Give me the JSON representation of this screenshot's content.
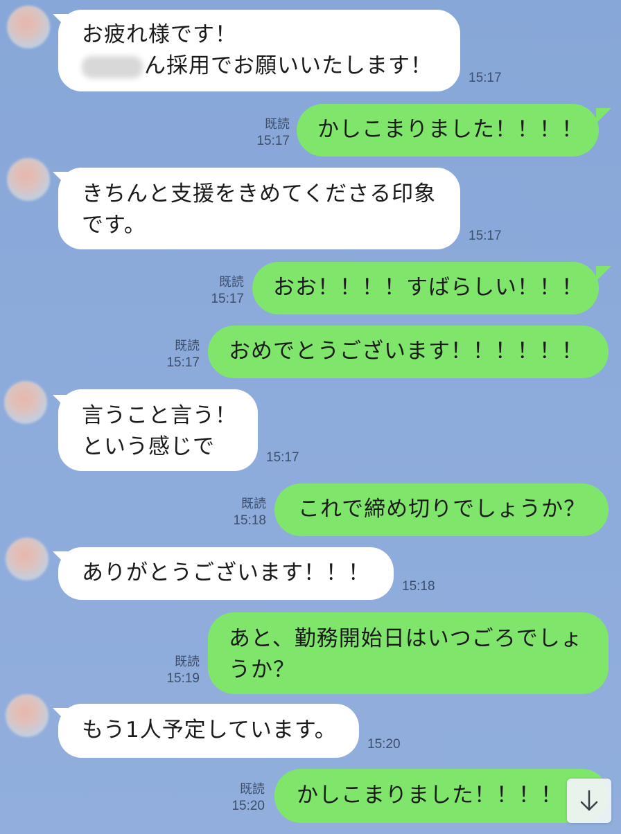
{
  "messages": [
    {
      "id": "m1",
      "side": "in",
      "lines": [
        "お疲れ様です！",
        "ん採用でお願いいたします！"
      ],
      "time": "15:17"
    },
    {
      "id": "m2",
      "side": "out",
      "text": "かしこまりました！！！！",
      "read": "既読",
      "time": "15:17"
    },
    {
      "id": "m3",
      "side": "in",
      "text": "きちんと支援をきめてくださる印象\nです。",
      "time": "15:17"
    },
    {
      "id": "m4",
      "side": "out",
      "text": "おお！！！！すばらしい！！！",
      "read": "既読",
      "time": "15:17"
    },
    {
      "id": "m5",
      "side": "out",
      "text": "おめでとうございます！！！！！！",
      "read": "既読",
      "time": "15:17"
    },
    {
      "id": "m6",
      "side": "in",
      "text": "言うこと言う！\nという感じで",
      "time": "15:17"
    },
    {
      "id": "m7",
      "side": "out",
      "text": "これで締め切りでしょうか？",
      "read": "既読",
      "time": "15:18"
    },
    {
      "id": "m8",
      "side": "in",
      "text": "ありがとうございます！！！",
      "time": "15:18"
    },
    {
      "id": "m9",
      "side": "out",
      "text": "あと、勤務開始日はいつごろでしょ\nうか？",
      "read": "既読",
      "time": "15:19"
    },
    {
      "id": "m10",
      "side": "in",
      "text": "もう1人予定しています。",
      "time": "15:20"
    },
    {
      "id": "m11",
      "side": "out",
      "text": "かしこまりました！！！！",
      "read": "既読",
      "time": "15:20"
    }
  ],
  "colors": {
    "background": "#8aa9d9",
    "incoming_bubble": "#ffffff",
    "outgoing_bubble": "#7fe56b",
    "meta_text": "#3c4e6b"
  },
  "icons": {
    "scroll_to_bottom": "arrow-down-icon",
    "sender_avatar": "avatar"
  }
}
